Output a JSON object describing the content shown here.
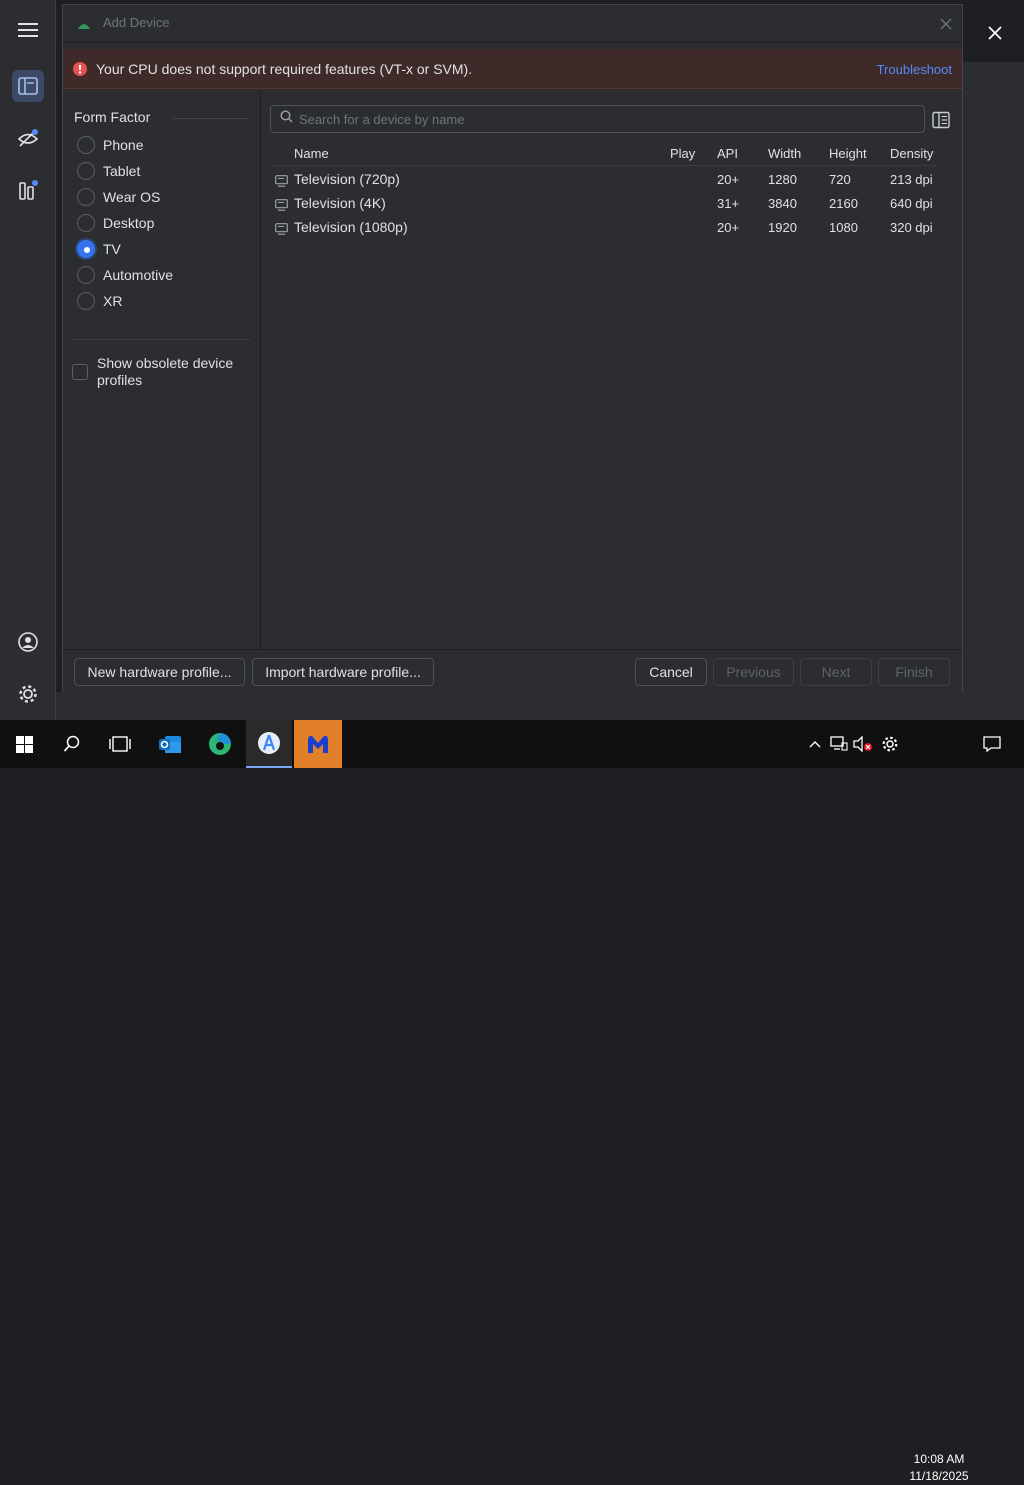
{
  "dialog": {
    "title": "Add Device",
    "close_icon": "close-icon"
  },
  "error": {
    "message": "Your CPU does not support required features (VT-x or SVM).",
    "link": "Troubleshoot",
    "icon": "error-icon",
    "color": "#e55353"
  },
  "form_factor": {
    "header": "Form Factor",
    "items": [
      {
        "label": "Phone",
        "checked": false
      },
      {
        "label": "Tablet",
        "checked": false
      },
      {
        "label": "Wear OS",
        "checked": false
      },
      {
        "label": "Desktop",
        "checked": false
      },
      {
        "label": "TV",
        "checked": true
      },
      {
        "label": "Automotive",
        "checked": false
      },
      {
        "label": "XR",
        "checked": false
      }
    ],
    "obsolete_label": "Show obsolete device profiles",
    "obsolete_checked": false
  },
  "device_list": {
    "search_placeholder": "Search for a device by name",
    "columns": [
      "Name",
      "Play",
      "API",
      "Width",
      "Height",
      "Density"
    ],
    "rows": [
      {
        "name": "Television (720p)",
        "play": "",
        "api": "20+",
        "width": "1280",
        "height": "720",
        "density": "213 dpi"
      },
      {
        "name": "Television (4K)",
        "play": "",
        "api": "31+",
        "width": "3840",
        "height": "2160",
        "density": "640 dpi"
      },
      {
        "name": "Television (1080p)",
        "play": "",
        "api": "20+",
        "width": "1920",
        "height": "1080",
        "density": "320 dpi"
      }
    ]
  },
  "footer": {
    "new_profile": "New hardware profile...",
    "import_profile": "Import hardware profile...",
    "cancel": "Cancel",
    "previous": "Previous",
    "next": "Next",
    "finish": "Finish"
  },
  "taskbar": {
    "time": "10:08 AM",
    "date": "11/18/2025"
  },
  "colors": {
    "accent": "#3574f0",
    "link": "#548af7",
    "dialog_bg": "#2b2d30"
  }
}
